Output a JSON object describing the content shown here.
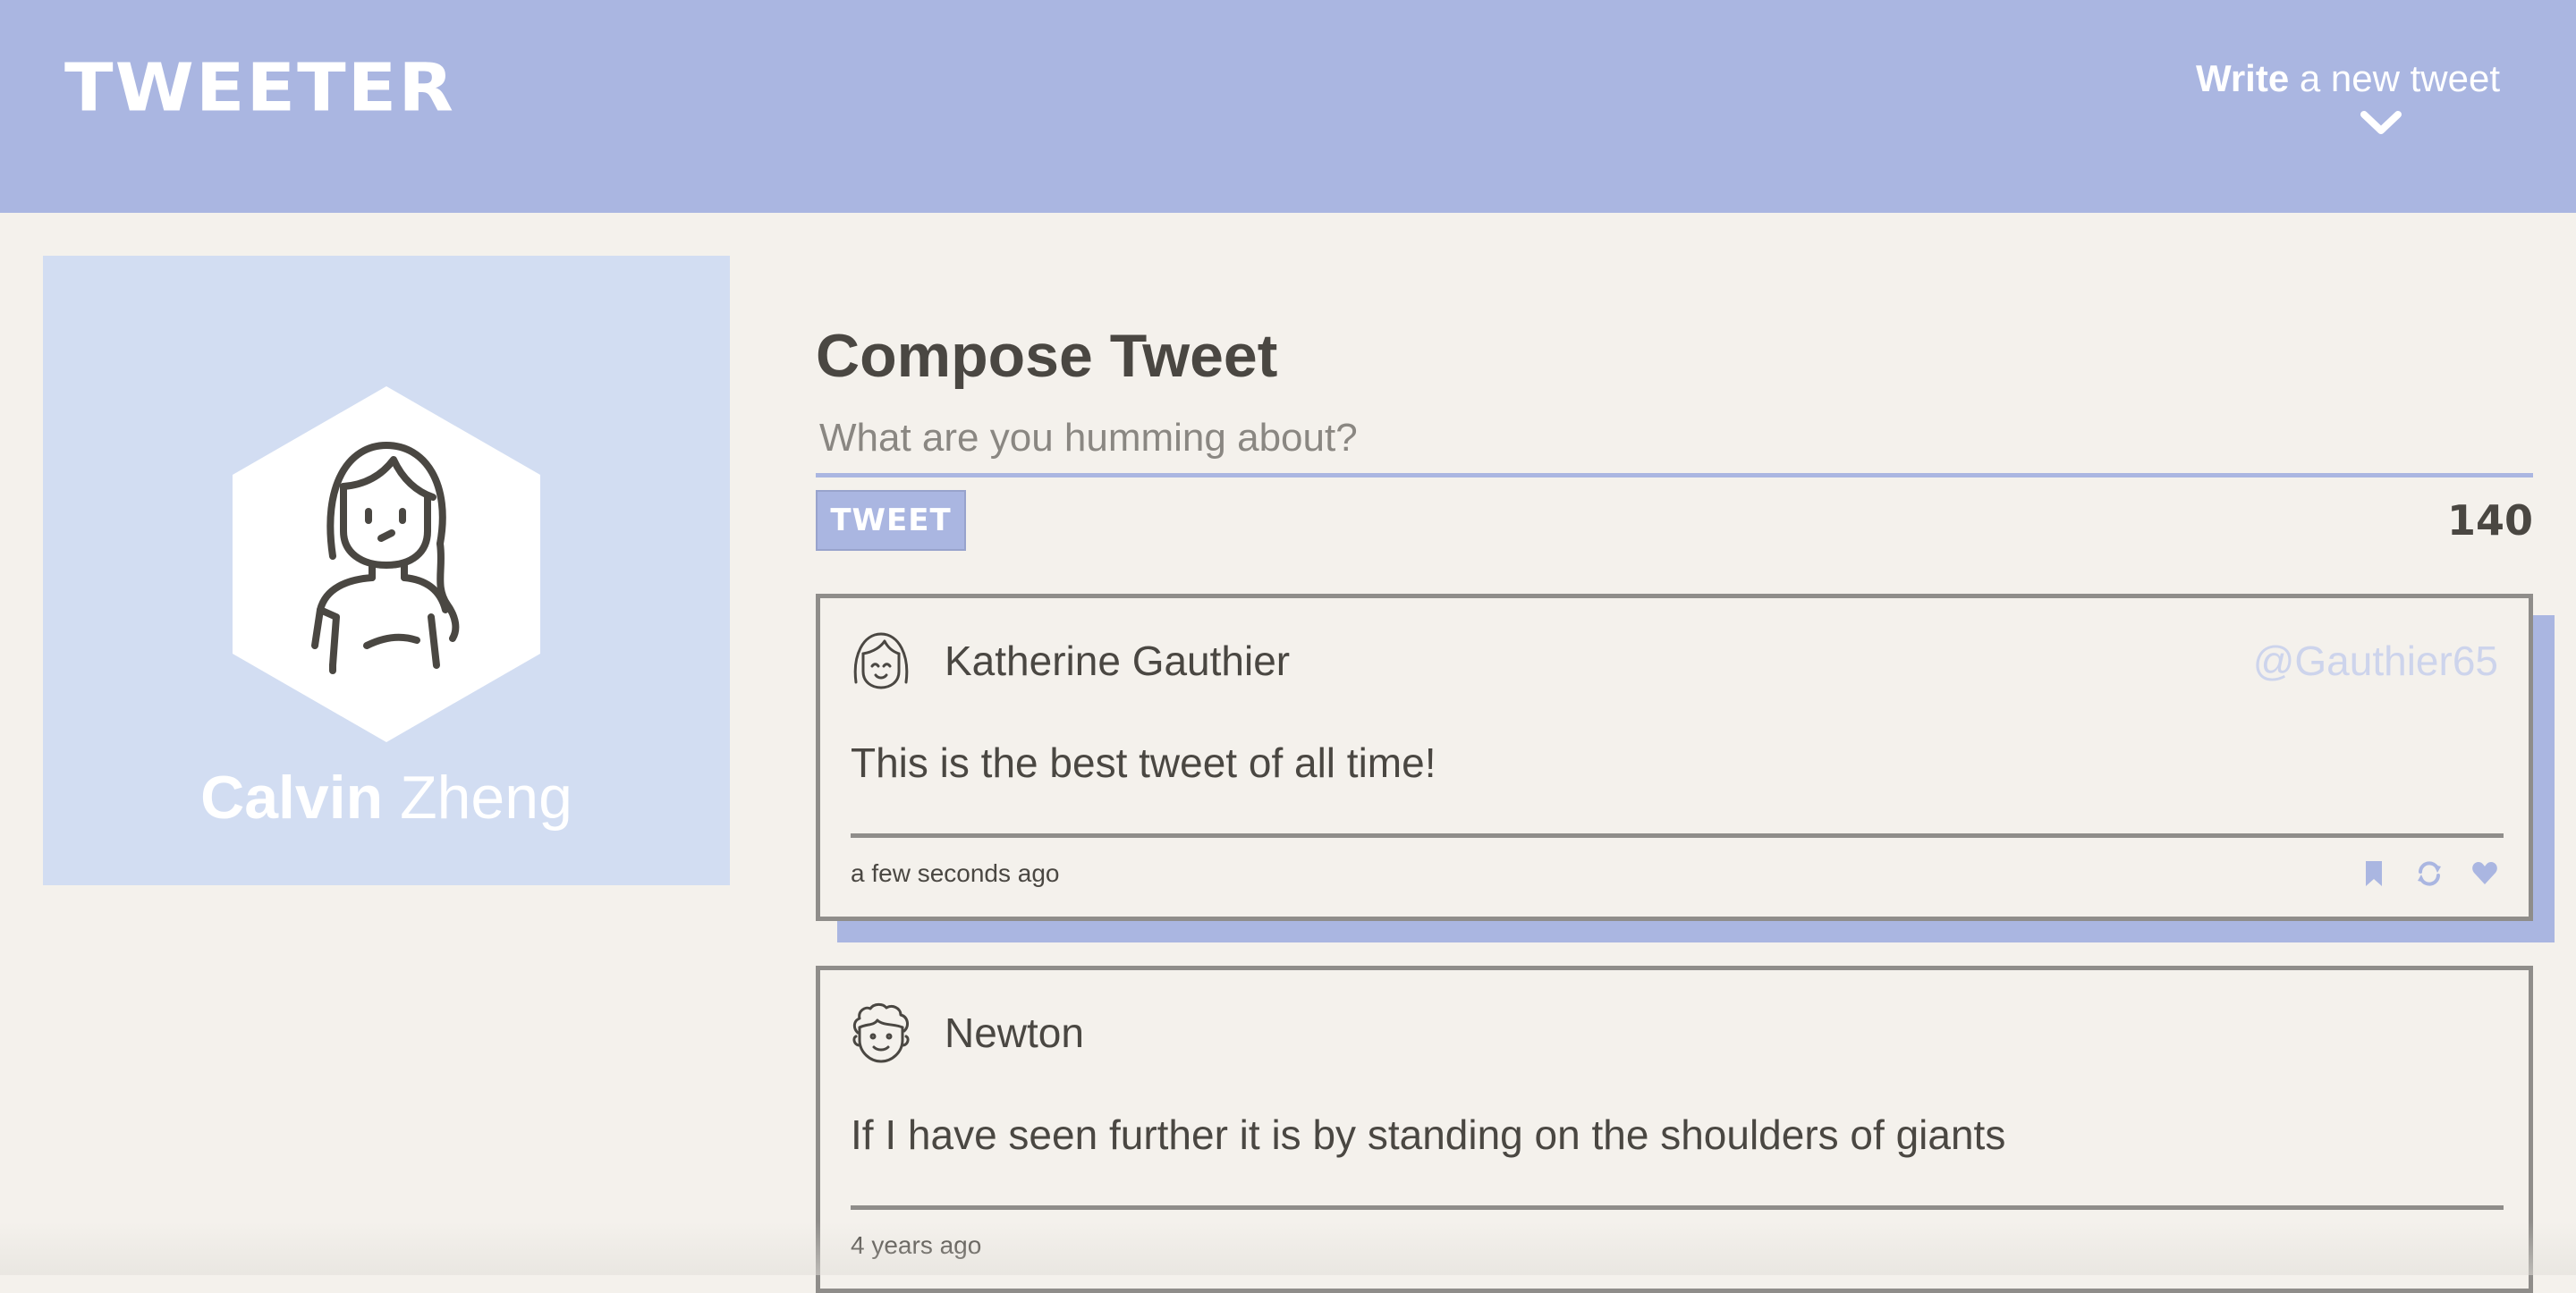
{
  "header": {
    "brand": "TWEETER",
    "compose_toggle_bold": "Write",
    "compose_toggle_rest": " a new tweet",
    "toggle_icon": "chevron-down-icon"
  },
  "profile": {
    "first_name": "Calvin",
    "last_name": " Zheng",
    "avatar_icon": "user-avatar-icon"
  },
  "compose": {
    "title": "Compose Tweet",
    "placeholder": "What are you humming about?",
    "button_label": "TWEET",
    "counter": "140"
  },
  "tweets": [
    {
      "author": "Katherine Gauthier",
      "handle": "@Gauthier65",
      "body": "This is the best tweet of all time!",
      "time": "a few seconds ago",
      "avatar_icon": "smiling-girl-avatar-icon"
    },
    {
      "author": "Newton",
      "handle": "",
      "body": "If I have seen further it is by standing on the shoulders of giants",
      "time": "4 years ago",
      "avatar_icon": "curly-hair-avatar-icon"
    }
  ],
  "action_icons": [
    "flag-icon",
    "retweet-icon",
    "heart-icon"
  ],
  "colors": {
    "accent": "#aab6e1",
    "background": "#f4f1ec",
    "profile_bg": "#d2ddf2",
    "text": "#4a4742",
    "border": "#8f8d8a"
  }
}
